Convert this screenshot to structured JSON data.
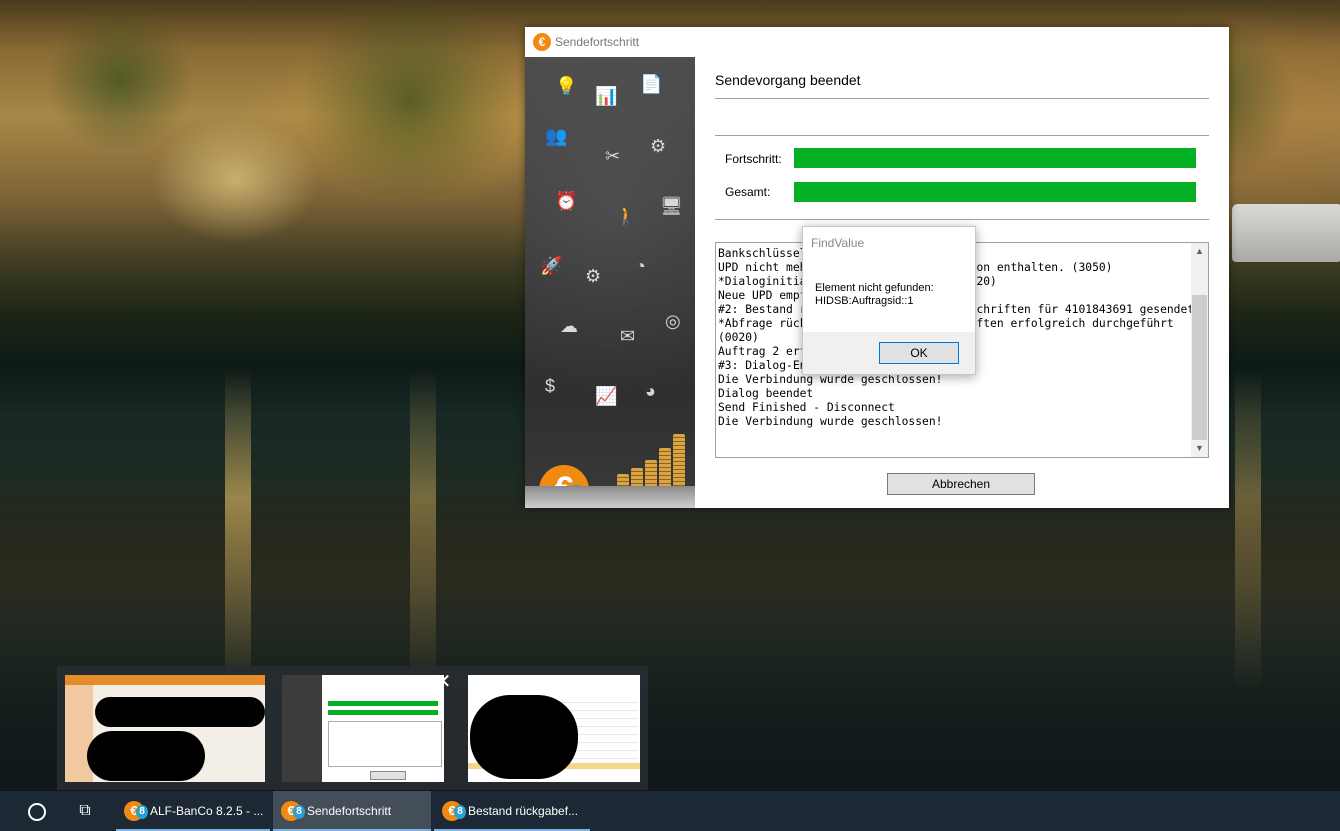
{
  "main_window": {
    "title": "Sendefortschritt",
    "heading": "Sendevorgang beendet",
    "progress_label": "Fortschritt:",
    "progress_value": 1.0,
    "total_label": "Gesamt:",
    "total_value": 1.0,
    "log_lines": [
      "Bankschlüssel",
      "UPD nicht meh                         on enthalten. (3050)",
      "*Dialoginitia                         20)",
      "Neue UPD empf",
      "#2: Bestand r                         chriften für 4101843691 gesendet",
      "*Abfrage rück                         ften erfolgreich durchgeführt",
      "(0020)",
      "Auftrag 2 erf",
      "#3: Dialog-Ende gesendet",
      "Die Verbindung wurde geschlossen!",
      "Dialog beendet",
      "Send Finished - Disconnect",
      "Die Verbindung wurde geschlossen!"
    ],
    "log_first_line": "Bankschlüssel",
    "cancel_label": "Abbrechen",
    "logo_glyph": "€",
    "logo_digit": "8"
  },
  "message_box": {
    "title": "FindValue",
    "message_line1": "Element nicht gefunden:",
    "message_line2": "HIDSB:Auftragsid::1",
    "ok_label": "OK"
  },
  "thumbnail_preview": {
    "close_glyph": "✕"
  },
  "taskbar": {
    "items": [
      {
        "label": "ALF-BanCo 8.2.5 - ...",
        "active": false
      },
      {
        "label": "Sendefortschritt",
        "active": true
      },
      {
        "label": "Bestand rückgabef...",
        "active": false
      }
    ],
    "icons": [
      "cortana-circle-icon",
      "task-view-icon",
      "alf-banco-app-icon"
    ]
  },
  "colors": {
    "progress_fill": "#06b025",
    "logo_orange": "#f08a12",
    "logo_blue": "#2a9fd4",
    "taskbar_bg": "#1c2834"
  }
}
